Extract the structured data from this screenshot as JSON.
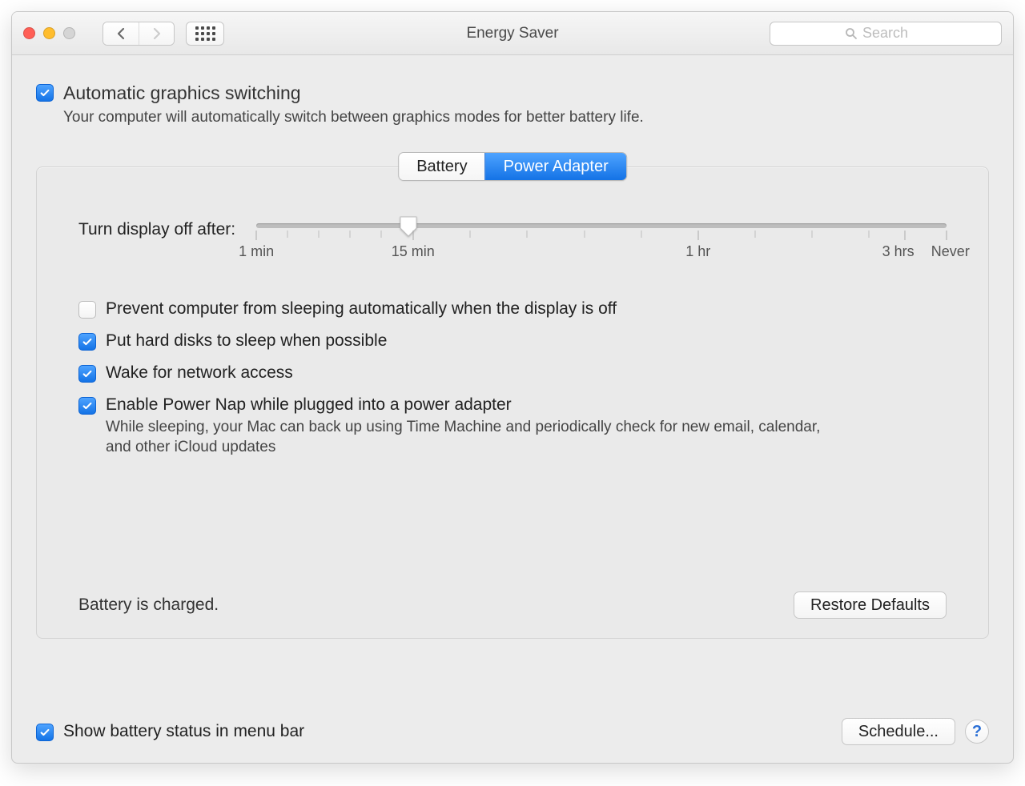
{
  "window": {
    "title": "Energy Saver"
  },
  "search": {
    "placeholder": "Search"
  },
  "auto_graphics": {
    "checked": true,
    "label": "Automatic graphics switching",
    "description": "Your computer will automatically switch between graphics modes for better battery life."
  },
  "tabs": {
    "battery": "Battery",
    "power_adapter": "Power Adapter",
    "active": "power_adapter"
  },
  "slider": {
    "label": "Turn display off after:",
    "ticks": {
      "min1": "1 min",
      "min15": "15 min",
      "hr1": "1 hr",
      "hrs3": "3 hrs",
      "never": "Never"
    }
  },
  "options": {
    "prevent_sleep": {
      "checked": false,
      "label": "Prevent computer from sleeping automatically when the display is off"
    },
    "hard_disks": {
      "checked": true,
      "label": "Put hard disks to sleep when possible"
    },
    "wake_network": {
      "checked": true,
      "label": "Wake for network access"
    },
    "power_nap": {
      "checked": true,
      "label": "Enable Power Nap while plugged into a power adapter",
      "description": "While sleeping, your Mac can back up using Time Machine and periodically check for new email, calendar, and other iCloud updates"
    }
  },
  "status": "Battery is charged.",
  "buttons": {
    "restore_defaults": "Restore Defaults",
    "schedule": "Schedule...",
    "help": "?"
  },
  "bottom": {
    "show_battery": {
      "checked": true,
      "label": "Show battery status in menu bar"
    }
  }
}
